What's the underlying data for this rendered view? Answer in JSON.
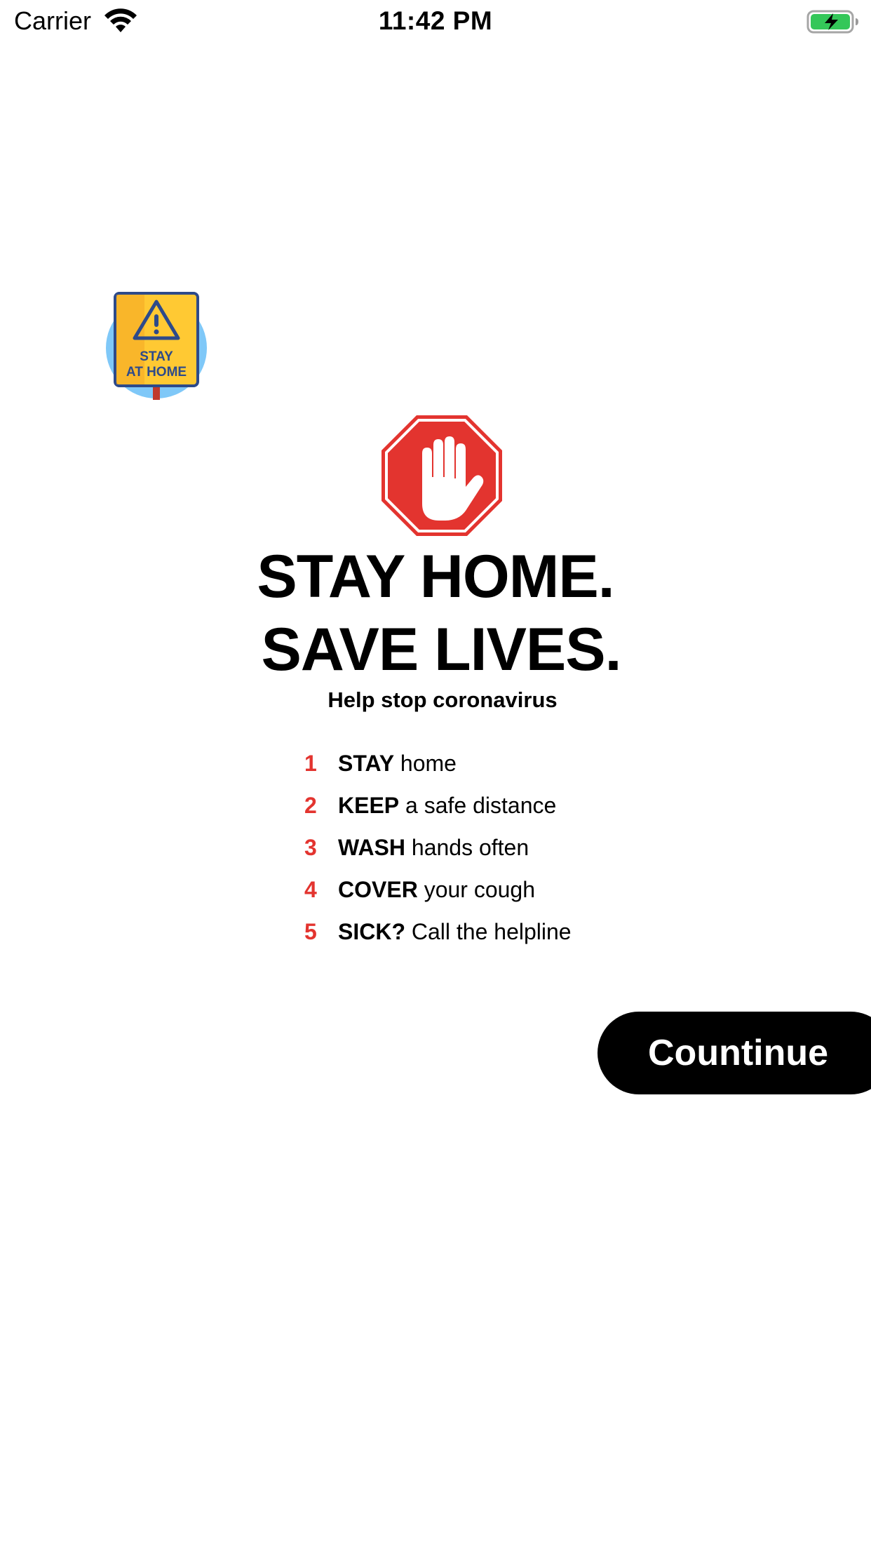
{
  "status_bar": {
    "carrier": "Carrier",
    "time": "11:42 PM",
    "wifi_icon": "wifi-icon",
    "battery_icon": "battery-charging-icon",
    "battery_color": "#34c759"
  },
  "badge": {
    "line1": "STAY",
    "line2": "AT HOME",
    "icon": "stay-at-home-sign-icon",
    "colors": {
      "circle": "#7fc8f8",
      "sign": "#ffc933",
      "border": "#2d4a8a"
    }
  },
  "poster": {
    "stop_icon": "stop-hand-icon",
    "stop_color": "#e3342f",
    "headline_1": "STAY HOME.",
    "headline_2": "SAVE LIVES.",
    "subheading": "Help stop coronavirus",
    "steps": [
      {
        "number": "1",
        "key": "STAY",
        "rest": " home"
      },
      {
        "number": "2",
        "key": "KEEP",
        "rest": " a safe distance"
      },
      {
        "number": "3",
        "key": "WASH",
        "rest": " hands often"
      },
      {
        "number": "4",
        "key": "COVER",
        "rest": " your cough"
      },
      {
        "number": "5",
        "key": "SICK?",
        "rest": " Call the helpline"
      }
    ]
  },
  "actions": {
    "continue_label": "Countinue"
  }
}
